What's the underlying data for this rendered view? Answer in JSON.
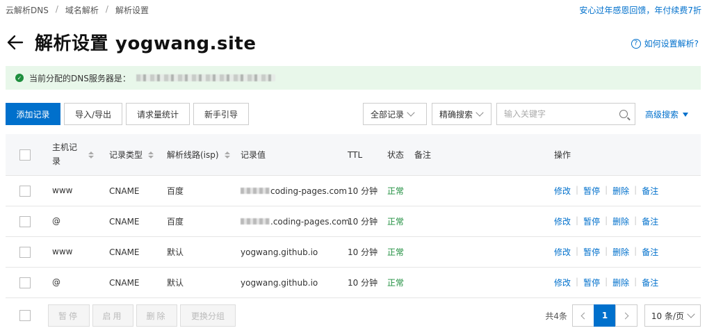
{
  "breadcrumb": [
    "云解析DNS",
    "域名解析",
    "解析设置"
  ],
  "promo": "安心过年感恩回馈，年付续费7折",
  "title": {
    "prefix": "解析设置",
    "domain": "yogwang.site"
  },
  "help_link": "如何设置解析?",
  "notice": {
    "text": "当前分配的DNS服务器是："
  },
  "toolbar": {
    "add": "添加记录",
    "import_export": "导入/导出",
    "stats": "请求量统计",
    "guide": "新手引导"
  },
  "filters": {
    "record_type": "全部记录",
    "search_mode": "精确搜索",
    "search_placeholder": "输入关键字",
    "advanced": "高级搜索"
  },
  "columns": {
    "host": "主机记录",
    "type": "记录类型",
    "line": "解析线路(isp)",
    "value": "记录值",
    "ttl": "TTL",
    "status": "状态",
    "note": "备注",
    "ops": "操作"
  },
  "rows": [
    {
      "host": "www",
      "type": "CNAME",
      "line": "百度",
      "value": "coding-pages.com",
      "ttl": "10 分钟",
      "status": "正常"
    },
    {
      "host": "@",
      "type": "CNAME",
      "line": "百度",
      "value": ".coding-pages.com",
      "ttl": "10 分钟",
      "status": "正常"
    },
    {
      "host": "www",
      "type": "CNAME",
      "line": "默认",
      "value": "yogwang.github.io",
      "ttl": "10 分钟",
      "status": "正常"
    },
    {
      "host": "@",
      "type": "CNAME",
      "line": "默认",
      "value": "yogwang.github.io",
      "ttl": "10 分钟",
      "status": "正常"
    }
  ],
  "row_actions": {
    "edit": "修改",
    "pause": "暂停",
    "delete": "删除",
    "note": "备注"
  },
  "bulk": {
    "pause": "暂停",
    "enable": "启用",
    "delete": "删除",
    "change_group": "更换分组"
  },
  "pagination": {
    "total": "共4条",
    "current": "1",
    "page_size": "10 条/页"
  },
  "colors": {
    "accent": "#0070cc",
    "success": "#1e8e3e",
    "notice_bg": "#e8f7ea"
  }
}
